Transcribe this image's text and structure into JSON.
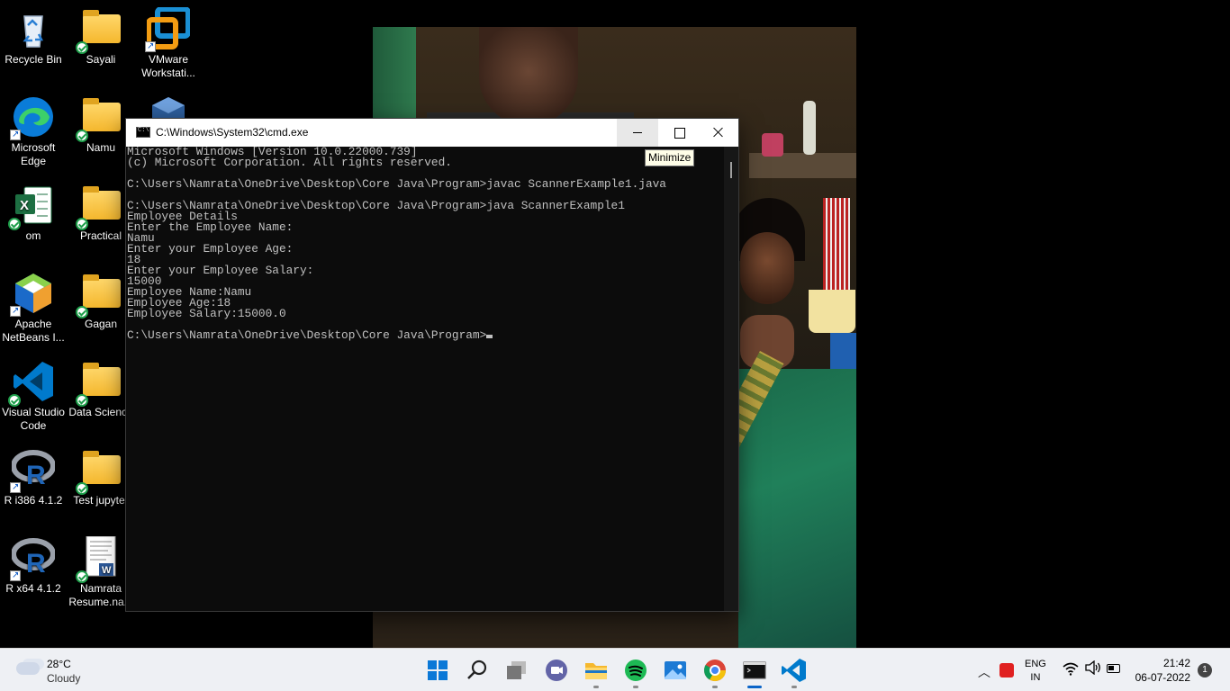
{
  "desktop": {
    "icons": [
      {
        "label": "Recycle Bin",
        "icon": "recycle-bin-icon"
      },
      {
        "label": "Sayali",
        "icon": "folder-icon"
      },
      {
        "label": "VMware Workstati...",
        "icon": "vmware-icon"
      },
      {
        "label": "Microsoft Edge",
        "icon": "edge-icon"
      },
      {
        "label": "Namu",
        "icon": "folder-icon"
      },
      {
        "label": "om",
        "icon": "excel-icon"
      },
      {
        "label": "Practical",
        "icon": "folder-icon"
      },
      {
        "label": "Apache NetBeans I...",
        "icon": "netbeans-icon"
      },
      {
        "label": "Gagan",
        "icon": "folder-icon"
      },
      {
        "label": "Visual Studio Code",
        "icon": "vscode-icon"
      },
      {
        "label": "Data Science",
        "icon": "folder-icon"
      },
      {
        "label": "R i386 4.1.2",
        "icon": "r-icon"
      },
      {
        "label": "Test jupyter",
        "icon": "folder-icon"
      },
      {
        "label": "R x64 4.1.2",
        "icon": "r-icon"
      },
      {
        "label": "Namrata Resume.na...",
        "icon": "word-document-icon"
      }
    ]
  },
  "cmd_window": {
    "title": "C:\\Windows\\System32\\cmd.exe",
    "tooltip": "Minimize",
    "lines": [
      "Microsoft Windows [Version 10.0.22000.739]",
      "(c) Microsoft Corporation. All rights reserved.",
      "",
      "C:\\Users\\Namrata\\OneDrive\\Desktop\\Core Java\\Program>javac ScannerExample1.java",
      "",
      "C:\\Users\\Namrata\\OneDrive\\Desktop\\Core Java\\Program>java ScannerExample1",
      "Employee Details",
      "Enter the Employee Name:",
      "Namu",
      "Enter your Employee Age:",
      "18",
      "Enter your Employee Salary:",
      "15000",
      "Employee Name:Namu",
      "Employee Age:18",
      "Employee Salary:15000.0",
      "",
      "C:\\Users\\Namrata\\OneDrive\\Desktop\\Core Java\\Program>"
    ]
  },
  "taskbar": {
    "weather_temp": "28°C",
    "weather_condition": "Cloudy",
    "apps": [
      "start-icon",
      "search-icon",
      "task-view-icon",
      "teams-chat-icon",
      "file-explorer-icon",
      "spotify-icon",
      "photos-icon",
      "chrome-icon",
      "cmd-icon",
      "vscode-icon"
    ],
    "lang_line1": "ENG",
    "lang_line2": "IN",
    "time": "21:42",
    "date": "06-07-2022",
    "notification_count": "1"
  }
}
